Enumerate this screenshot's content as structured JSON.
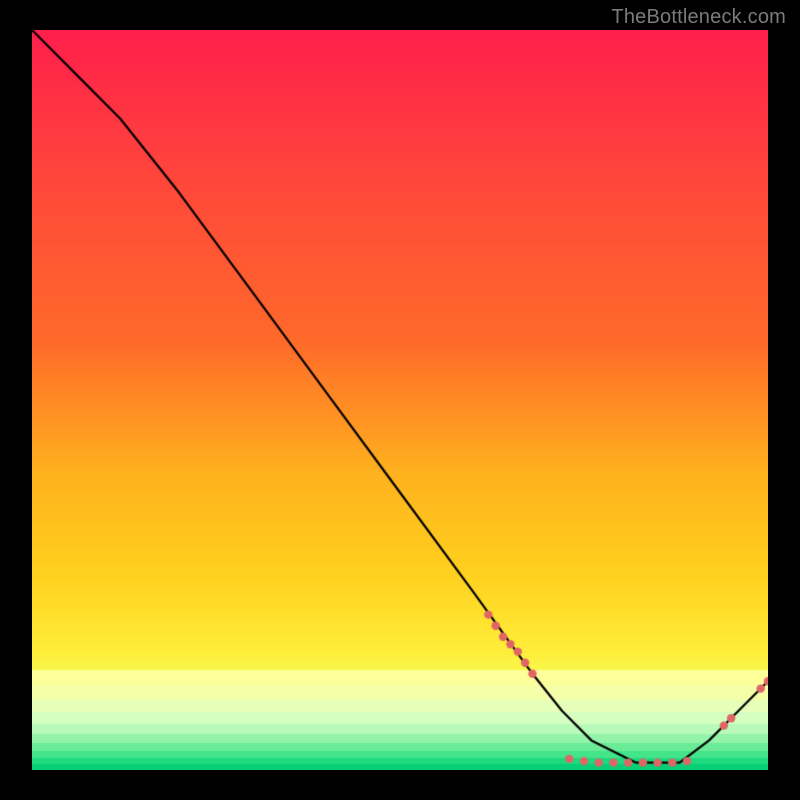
{
  "watermark": "TheBottleneck.com",
  "chart_data": {
    "type": "line",
    "title": "",
    "xlabel": "",
    "ylabel": "",
    "xlim": [
      0,
      100
    ],
    "ylim": [
      0,
      100
    ],
    "grid": false,
    "series": [
      {
        "name": "curve",
        "x": [
          0,
          6,
          12,
          20,
          30,
          40,
          50,
          60,
          68,
          72,
          76,
          82,
          88,
          92,
          96,
          100
        ],
        "y": [
          100,
          94,
          88,
          78,
          64.5,
          51,
          37.5,
          24,
          13,
          8,
          4,
          1,
          1,
          4,
          8,
          12
        ]
      }
    ],
    "markers": [
      {
        "x": 62,
        "y": 21
      },
      {
        "x": 63,
        "y": 19.5
      },
      {
        "x": 64,
        "y": 18
      },
      {
        "x": 65,
        "y": 17
      },
      {
        "x": 66,
        "y": 16
      },
      {
        "x": 67,
        "y": 14.5
      },
      {
        "x": 68,
        "y": 13
      },
      {
        "x": 73,
        "y": 1.5
      },
      {
        "x": 75,
        "y": 1.2
      },
      {
        "x": 77,
        "y": 1.0
      },
      {
        "x": 79,
        "y": 1.0
      },
      {
        "x": 81,
        "y": 1.0
      },
      {
        "x": 83,
        "y": 1.0
      },
      {
        "x": 85,
        "y": 1.0
      },
      {
        "x": 87,
        "y": 1.0
      },
      {
        "x": 89,
        "y": 1.2
      },
      {
        "x": 94,
        "y": 6
      },
      {
        "x": 95,
        "y": 7
      },
      {
        "x": 99,
        "y": 11
      },
      {
        "x": 100,
        "y": 12
      }
    ],
    "colors": {
      "gradient_top": "#ff1f4b",
      "gradient_mid1": "#ff6a2a",
      "gradient_mid2": "#ffd21f",
      "gradient_low": "#f3ff57",
      "gradient_band_pale": "#e8ffb8",
      "gradient_band_green": "#2be07a",
      "gradient_bottom": "#00d47a",
      "line": "#000000",
      "marker": "#e06666",
      "background": "#000000"
    }
  }
}
